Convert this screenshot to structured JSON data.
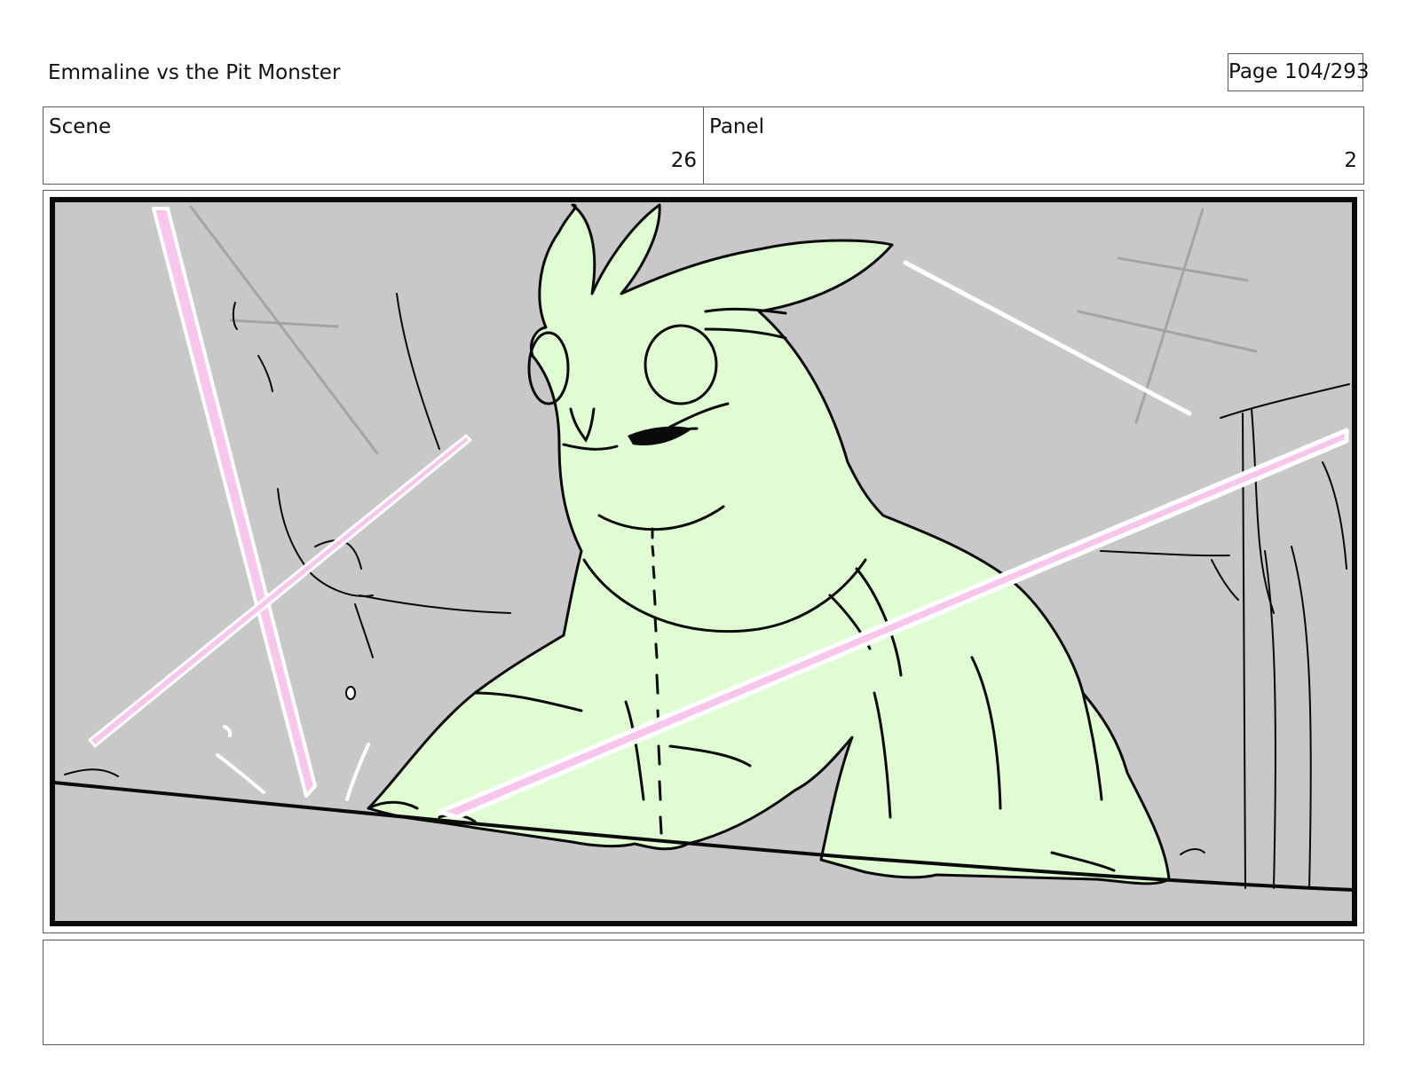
{
  "header": {
    "project_title": "Emmaline vs the Pit Monster",
    "page_label": "Page 104/293"
  },
  "info": {
    "scene_label": "Scene",
    "scene_value": "26",
    "panel_label": "Panel",
    "panel_value": "2"
  },
  "panel": {
    "background_color": "#c8c8c8",
    "creature_color": "#e0fcd2",
    "beam_color": "#f8c6ec",
    "line_color": "#0a0a0a"
  },
  "notes": {
    "text": ""
  }
}
